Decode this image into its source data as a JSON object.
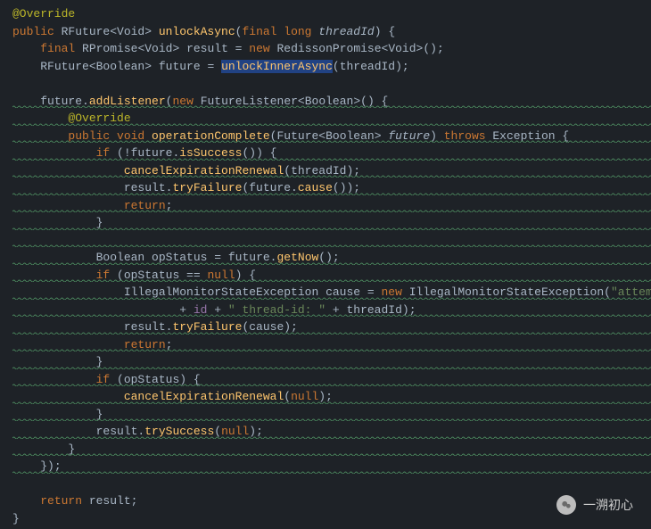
{
  "code": {
    "l1": {
      "annot": "@Override"
    },
    "l2": {
      "kw1": "public ",
      "type": "RFuture",
      "gen": "<Void> ",
      "method": "unlockAsync",
      "paren1": "(",
      "kw2": "final long ",
      "param": "threadId",
      "paren2": ") {"
    },
    "l3": {
      "indent": "    ",
      "kw": "final ",
      "type1": "RPromise",
      "gen1": "<Void> ",
      "var": "result ",
      "eq": "= ",
      "kw2": "new ",
      "type2": "RedissonPromise",
      "gen2": "<Void>",
      "tail": "();"
    },
    "l4": {
      "indent": "    ",
      "type": "RFuture",
      "gen": "<Boolean> ",
      "var": "future ",
      "eq": "= ",
      "method": "unlockInnerAsync",
      "args": "(threadId);"
    },
    "l6": {
      "indent": "    ",
      "obj": "future",
      "dot": ".",
      "method": "addListener",
      "paren": "(",
      "kw": "new ",
      "type": "FutureListener",
      "gen": "<Boolean>",
      "tail": "() {"
    },
    "l7": {
      "indent": "        ",
      "annot": "@Override"
    },
    "l8": {
      "indent": "        ",
      "kw": "public void ",
      "method": "operationComplete",
      "paren1": "(",
      "type": "Future",
      "gen": "<Boolean> ",
      "param": "future",
      "paren2": ")",
      "kw2": " throws ",
      "type2": "Exception",
      "brace": " {"
    },
    "l9": {
      "indent": "            ",
      "kw": "if ",
      "cond": "(!future.",
      "method": "isSuccess",
      "tail": "()) {"
    },
    "l10": {
      "indent": "                ",
      "method": "cancelExpirationRenewal",
      "args": "(threadId);"
    },
    "l11": {
      "indent": "                ",
      "obj": "result.",
      "method": "tryFailure",
      "mid": "(future.",
      "method2": "cause",
      "tail": "());"
    },
    "l12": {
      "indent": "                ",
      "kw": "return",
      "semi": ";"
    },
    "l13": {
      "indent": "            ",
      "brace": "}"
    },
    "l15": {
      "indent": "            ",
      "type": "Boolean ",
      "var": "opStatus ",
      "eq": "= future.",
      "method": "getNow",
      "tail": "();"
    },
    "l16": {
      "indent": "            ",
      "kw": "if ",
      "cond": "(opStatus == ",
      "kw2": "null",
      "tail": ") {"
    },
    "l17": {
      "indent": "                ",
      "type": "IllegalMonitorStateException ",
      "var": "cause ",
      "eq": "= ",
      "kw": "new ",
      "type2": "IllegalMonitorStateException",
      "paren": "(",
      "str": "\"attemp"
    },
    "l18": {
      "indent": "                        ",
      "plus": "+ ",
      "field": "id",
      "plus2": " + ",
      "str": "\" thread-id: \"",
      "plus3": " + threadId);"
    },
    "l19": {
      "indent": "                ",
      "obj": "result.",
      "method": "tryFailure",
      "args": "(cause);"
    },
    "l20": {
      "indent": "                ",
      "kw": "return",
      "semi": ";"
    },
    "l21": {
      "indent": "            ",
      "brace": "}"
    },
    "l22": {
      "indent": "            ",
      "kw": "if ",
      "cond": "(opStatus) {"
    },
    "l23": {
      "indent": "                ",
      "method": "cancelExpirationRenewal",
      "paren": "(",
      "kw": "null",
      "tail": ");"
    },
    "l24": {
      "indent": "            ",
      "brace": "}"
    },
    "l25": {
      "indent": "            ",
      "obj": "result.",
      "method": "trySuccess",
      "paren": "(",
      "kw": "null",
      "tail": ");"
    },
    "l26": {
      "indent": "        ",
      "brace": "}"
    },
    "l27": {
      "indent": "    ",
      "tail": "});"
    },
    "l29": {
      "indent": "    ",
      "kw": "return ",
      "var": "result;"
    },
    "l30": {
      "brace": "}"
    }
  },
  "watermark": {
    "text": "一溯初心"
  }
}
